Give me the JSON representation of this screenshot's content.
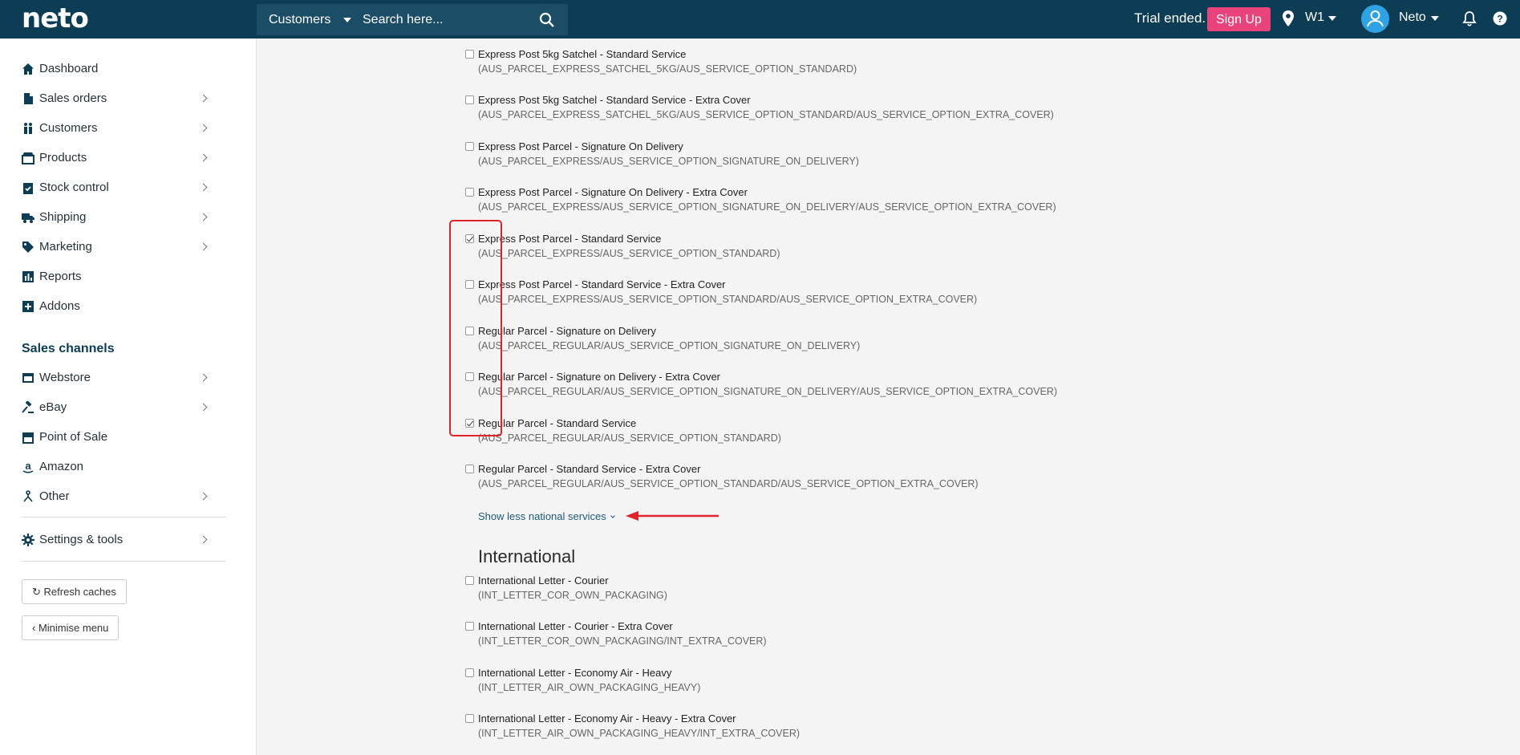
{
  "topbar": {
    "logo": "neto",
    "search_scope": "Customers",
    "search_placeholder": "Search here...",
    "trial_text": "Trial ended.",
    "signup_label": "Sign Up",
    "location": "W1",
    "user_name": "Neto"
  },
  "sidebar": {
    "items": [
      {
        "label": "Dashboard",
        "icon": "home-icon"
      },
      {
        "label": "Sales orders",
        "icon": "document-icon"
      },
      {
        "label": "Customers",
        "icon": "people-icon"
      },
      {
        "label": "Products",
        "icon": "box-icon"
      },
      {
        "label": "Stock control",
        "icon": "clipboard-icon"
      },
      {
        "label": "Shipping",
        "icon": "truck-icon"
      },
      {
        "label": "Marketing",
        "icon": "tag-icon"
      },
      {
        "label": "Reports",
        "icon": "bar-chart-icon"
      },
      {
        "label": "Addons",
        "icon": "plus-square-icon"
      }
    ],
    "section_title": "Sales channels",
    "channels": [
      {
        "label": "Webstore",
        "icon": "browser-icon"
      },
      {
        "label": "eBay",
        "icon": "gavel-icon"
      },
      {
        "label": "Point of Sale",
        "icon": "store-icon"
      },
      {
        "label": "Amazon",
        "icon": "amazon-icon"
      },
      {
        "label": "Other",
        "icon": "sitemap-icon"
      }
    ],
    "settings_label": "Settings & tools",
    "refresh_label": "Refresh caches",
    "minimise_label": "Minimise menu"
  },
  "services": {
    "national": [
      {
        "title": "Express Post 5kg Satchel - Standard Service",
        "code": "(AUS_PARCEL_EXPRESS_SATCHEL_5KG/AUS_SERVICE_OPTION_STANDARD)",
        "checked": false
      },
      {
        "title": "Express Post 5kg Satchel - Standard Service - Extra Cover",
        "code": "(AUS_PARCEL_EXPRESS_SATCHEL_5KG/AUS_SERVICE_OPTION_STANDARD/AUS_SERVICE_OPTION_EXTRA_COVER)",
        "checked": false
      },
      {
        "title": "Express Post Parcel - Signature On Delivery",
        "code": "(AUS_PARCEL_EXPRESS/AUS_SERVICE_OPTION_SIGNATURE_ON_DELIVERY)",
        "checked": false
      },
      {
        "title": "Express Post Parcel - Signature On Delivery - Extra Cover",
        "code": "(AUS_PARCEL_EXPRESS/AUS_SERVICE_OPTION_SIGNATURE_ON_DELIVERY/AUS_SERVICE_OPTION_EXTRA_COVER)",
        "checked": false
      },
      {
        "title": "Express Post Parcel - Standard Service",
        "code": "(AUS_PARCEL_EXPRESS/AUS_SERVICE_OPTION_STANDARD)",
        "checked": true
      },
      {
        "title": "Express Post Parcel - Standard Service - Extra Cover",
        "code": "(AUS_PARCEL_EXPRESS/AUS_SERVICE_OPTION_STANDARD/AUS_SERVICE_OPTION_EXTRA_COVER)",
        "checked": false
      },
      {
        "title": "Regular Parcel - Signature on Delivery",
        "code": "(AUS_PARCEL_REGULAR/AUS_SERVICE_OPTION_SIGNATURE_ON_DELIVERY)",
        "checked": false
      },
      {
        "title": "Regular Parcel - Signature on Delivery - Extra Cover",
        "code": "(AUS_PARCEL_REGULAR/AUS_SERVICE_OPTION_SIGNATURE_ON_DELIVERY/AUS_SERVICE_OPTION_EXTRA_COVER)",
        "checked": false
      },
      {
        "title": "Regular Parcel - Standard Service",
        "code": "(AUS_PARCEL_REGULAR/AUS_SERVICE_OPTION_STANDARD)",
        "checked": true
      },
      {
        "title": "Regular Parcel - Standard Service - Extra Cover",
        "code": "(AUS_PARCEL_REGULAR/AUS_SERVICE_OPTION_STANDARD/AUS_SERVICE_OPTION_EXTRA_COVER)",
        "checked": false
      }
    ],
    "show_less_label": "Show less national services",
    "international_heading": "International",
    "international": [
      {
        "title": "International Letter - Courier",
        "code": "(INT_LETTER_COR_OWN_PACKAGING)",
        "checked": false
      },
      {
        "title": "International Letter - Courier - Extra Cover",
        "code": "(INT_LETTER_COR_OWN_PACKAGING/INT_EXTRA_COVER)",
        "checked": false
      },
      {
        "title": "International Letter - Economy Air - Heavy",
        "code": "(INT_LETTER_AIR_OWN_PACKAGING_HEAVY)",
        "checked": false
      },
      {
        "title": "International Letter - Economy Air - Heavy - Extra Cover",
        "code": "(INT_LETTER_AIR_OWN_PACKAGING_HEAVY/INT_EXTRA_COVER)",
        "checked": false
      }
    ]
  },
  "colors": {
    "topbar": "#0d3c55",
    "accent_pink": "#e8437b",
    "annotation_red": "#e0252a",
    "link": "#205b7b"
  }
}
